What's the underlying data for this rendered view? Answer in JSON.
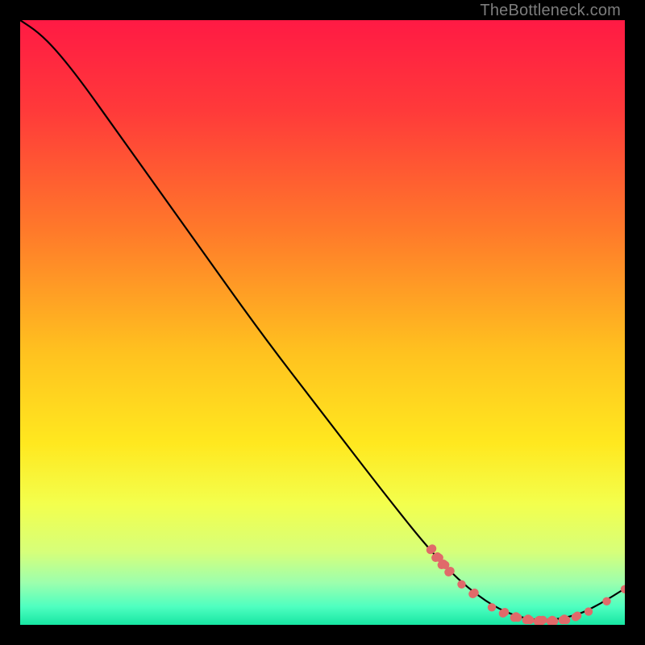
{
  "attribution": "TheBottleneck.com",
  "chart_data": {
    "type": "line",
    "title": "",
    "xlabel": "",
    "ylabel": "",
    "xlim": [
      0,
      100
    ],
    "ylim": [
      0,
      100
    ],
    "gradient_stops": [
      {
        "offset": 0,
        "color": "#ff1a44"
      },
      {
        "offset": 15,
        "color": "#ff3a3a"
      },
      {
        "offset": 35,
        "color": "#ff7a2a"
      },
      {
        "offset": 55,
        "color": "#ffc21f"
      },
      {
        "offset": 70,
        "color": "#ffe81f"
      },
      {
        "offset": 80,
        "color": "#f3ff4d"
      },
      {
        "offset": 88,
        "color": "#d6ff7a"
      },
      {
        "offset": 93,
        "color": "#9dffad"
      },
      {
        "offset": 97,
        "color": "#4effc0"
      },
      {
        "offset": 100,
        "color": "#17e6a3"
      }
    ],
    "curve": [
      {
        "x": 0,
        "y": 100
      },
      {
        "x": 3,
        "y": 98
      },
      {
        "x": 6,
        "y": 95
      },
      {
        "x": 10,
        "y": 90
      },
      {
        "x": 15,
        "y": 83
      },
      {
        "x": 20,
        "y": 76
      },
      {
        "x": 30,
        "y": 62
      },
      {
        "x": 40,
        "y": 48
      },
      {
        "x": 50,
        "y": 35
      },
      {
        "x": 60,
        "y": 22
      },
      {
        "x": 68,
        "y": 12
      },
      {
        "x": 74,
        "y": 6
      },
      {
        "x": 80,
        "y": 2
      },
      {
        "x": 86,
        "y": 0.5
      },
      {
        "x": 92,
        "y": 1.5
      },
      {
        "x": 96,
        "y": 3.5
      },
      {
        "x": 100,
        "y": 6
      }
    ],
    "marker_clusters": [
      {
        "x": 68,
        "y": 12.5,
        "n": 2
      },
      {
        "x": 69,
        "y": 11.2,
        "n": 3
      },
      {
        "x": 70,
        "y": 10.0,
        "n": 3
      },
      {
        "x": 71,
        "y": 8.8,
        "n": 2
      },
      {
        "x": 73,
        "y": 6.8,
        "n": 1
      },
      {
        "x": 75,
        "y": 5.2,
        "n": 2
      },
      {
        "x": 78,
        "y": 3.0,
        "n": 1
      },
      {
        "x": 80,
        "y": 2.0,
        "n": 2
      },
      {
        "x": 82,
        "y": 1.3,
        "n": 3
      },
      {
        "x": 84,
        "y": 0.9,
        "n": 3
      },
      {
        "x": 86,
        "y": 0.7,
        "n": 4
      },
      {
        "x": 88,
        "y": 0.7,
        "n": 3
      },
      {
        "x": 90,
        "y": 0.9,
        "n": 3
      },
      {
        "x": 92,
        "y": 1.4,
        "n": 2
      },
      {
        "x": 94,
        "y": 2.3,
        "n": 1
      },
      {
        "x": 97,
        "y": 4.0,
        "n": 1
      },
      {
        "x": 100,
        "y": 6.0,
        "n": 1
      }
    ],
    "marker_color": "#e06a6a",
    "curve_color": "#000000"
  }
}
